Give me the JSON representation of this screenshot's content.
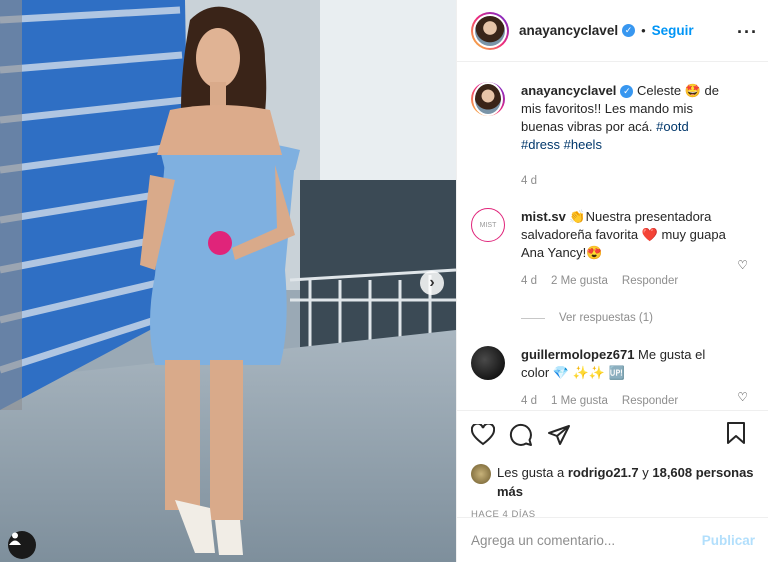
{
  "header": {
    "username": "anayancyclavel",
    "separator": "•",
    "follow_label": "Seguir",
    "more_icon": "more-horizontal-icon"
  },
  "caption": {
    "username": "anayancyclavel",
    "text_before": " Celeste ",
    "emoji": "🤩",
    "text_after": " de mis favoritos!! Les mando mis buenas vibras por acá. ",
    "hashtags": "#ootd #dress #heels",
    "time": "4 d"
  },
  "comments": [
    {
      "username": "mist.sv",
      "text": " 👏Nuestra presentadora salvadoreña favorita ❤️ muy guapa Ana Yancy!😍",
      "time": "4 d",
      "likes": "2 Me gusta",
      "reply": "Responder",
      "view_replies": "Ver respuestas (1)"
    },
    {
      "username": "guillermolopez671",
      "text": " Me gusta el color 💎 ✨✨ 🆙",
      "time": "4 d",
      "likes": "1 Me gusta",
      "reply": "Responder"
    }
  ],
  "likes": {
    "prefix": "Les gusta a ",
    "user": "rodrigo21.7",
    "mid": " y ",
    "count": "18,608 personas más"
  },
  "posted_ago": "HACE 4 DÍAS",
  "add_comment": {
    "placeholder": "Agrega un comentario...",
    "publish_label": "Publicar"
  },
  "colors": {
    "accent": "#0095f6",
    "verified": "#3897f0",
    "muted": "#8e8e8e",
    "dress": "#7fb0e0",
    "wall_blue": "#3d7fd0"
  }
}
